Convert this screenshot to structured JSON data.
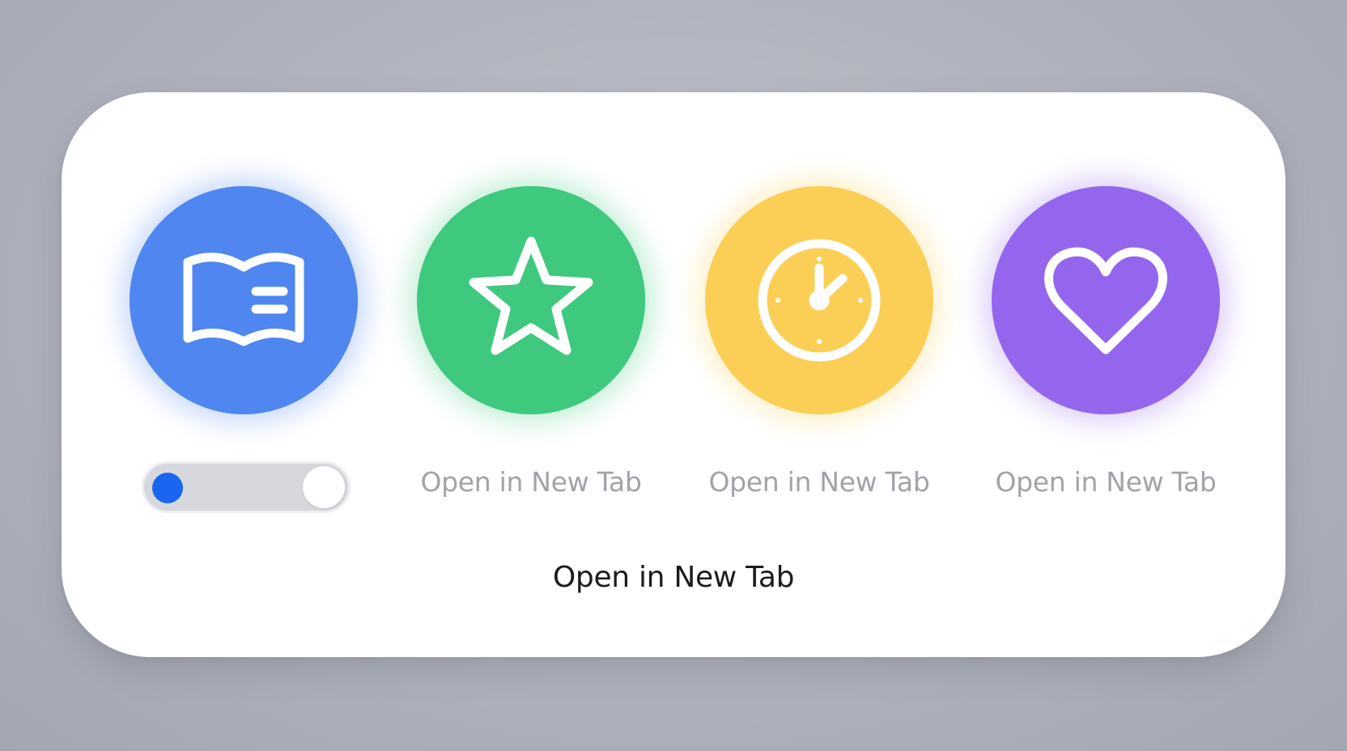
{
  "colors": {
    "blue": "#4f86ef",
    "green": "#3ec97e",
    "yellow": "#fbcf56",
    "purple": "#9466ee",
    "toggle_dot": "#1a66f0",
    "label_muted": "#a1a3aa",
    "caption_text": "#1b1c1f"
  },
  "tiles": [
    {
      "icon": "book-icon",
      "color": "blue"
    },
    {
      "icon": "star-icon",
      "color": "green"
    },
    {
      "icon": "clock-icon",
      "color": "yellow"
    },
    {
      "icon": "heart-icon",
      "color": "purple"
    }
  ],
  "toggle": {
    "state": "off"
  },
  "labels": [
    "Open in New Tab",
    "Open in New Tab",
    "Open in New Tab"
  ],
  "caption": "Open in New Tab"
}
